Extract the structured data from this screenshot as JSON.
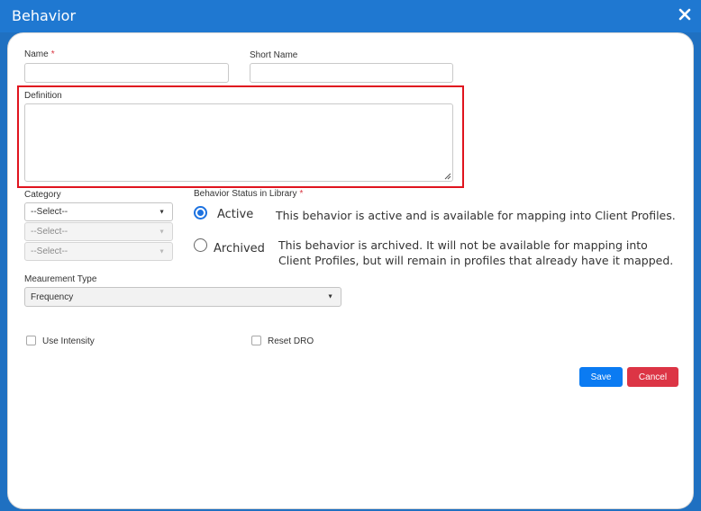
{
  "dialog": {
    "title": "Behavior"
  },
  "form": {
    "name_label": "Name",
    "required_mark": "*",
    "name_value": "",
    "short_name_label": "Short Name",
    "short_name_value": "",
    "definition_label": "Definition",
    "definition_value": "",
    "category_label": "Category",
    "category_selects": [
      {
        "value": "--Select--",
        "enabled": true
      },
      {
        "value": "--Select--",
        "enabled": false
      },
      {
        "value": "--Select--",
        "enabled": false
      }
    ],
    "status_label": "Behavior Status in Library",
    "status_options": [
      {
        "label": "Active",
        "selected": true,
        "description": "This behavior is active and is available for mapping into Client Profiles."
      },
      {
        "label": "Archived",
        "selected": false,
        "description": "This behavior is archived. It will not be available for mapping into Client Profiles, but will remain in profiles that already have it mapped."
      }
    ],
    "measurement_label": "Meaurement Type",
    "measurement_value": "Frequency",
    "use_intensity_label": "Use Intensity",
    "use_intensity_checked": false,
    "reset_dro_label": "Reset DRO",
    "reset_dro_checked": false
  },
  "actions": {
    "save_label": "Save",
    "cancel_label": "Cancel"
  },
  "colors": {
    "titlebar": "#1f78d1",
    "highlight": "#e0141e",
    "save": "#0b7bf2",
    "cancel": "#dc3545",
    "radio_selected": "#1d72e0"
  }
}
